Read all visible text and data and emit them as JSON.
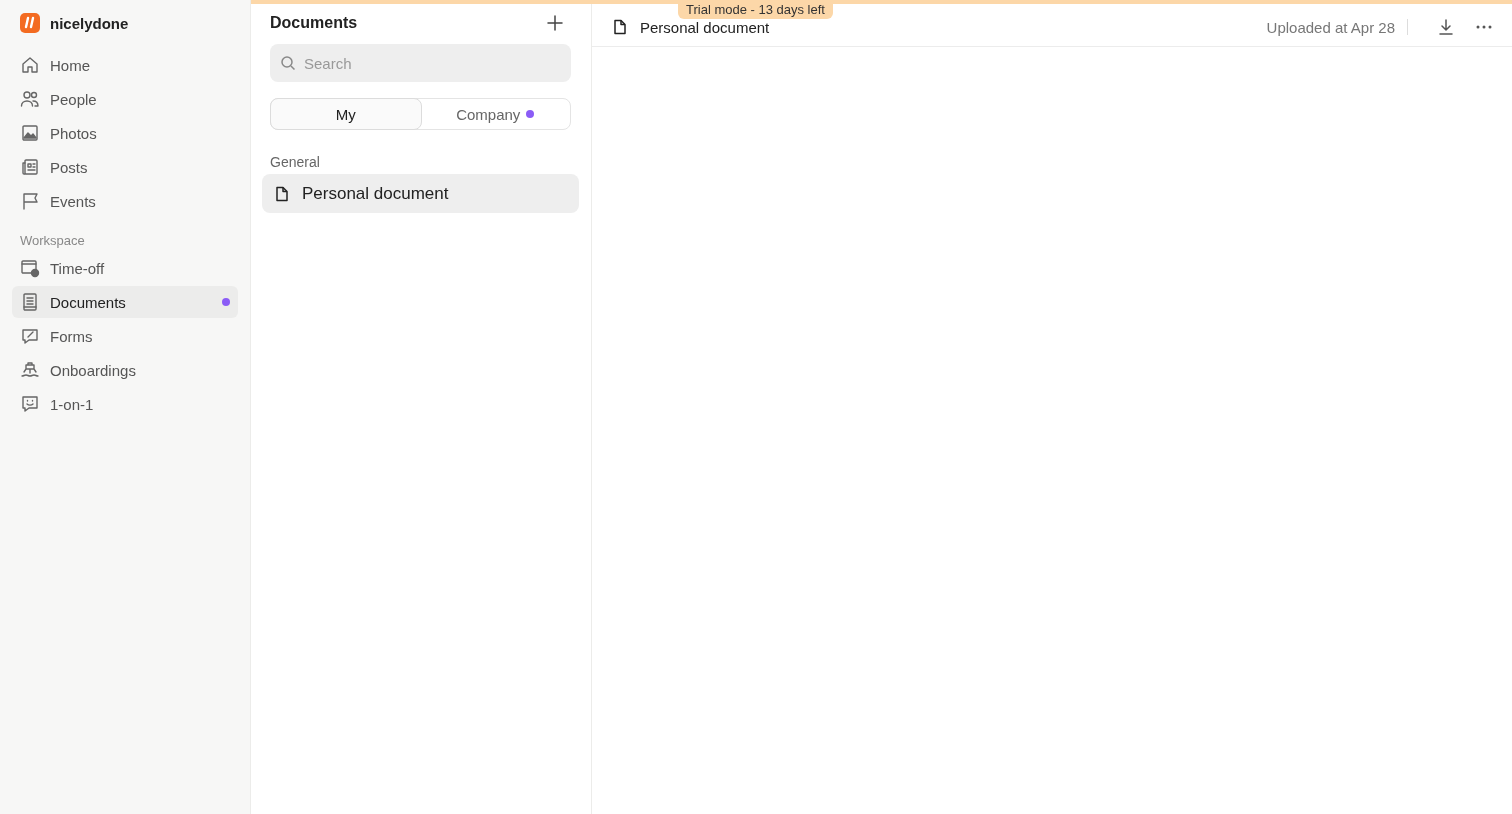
{
  "app": {
    "name": "nicelydone"
  },
  "sidebar": {
    "items": [
      {
        "label": "Home",
        "kind": "home",
        "selected": false,
        "unread": false
      },
      {
        "label": "People",
        "kind": "people",
        "selected": false,
        "unread": false
      },
      {
        "label": "Photos",
        "kind": "photos",
        "selected": false,
        "unread": false
      },
      {
        "label": "Posts",
        "kind": "posts",
        "selected": false,
        "unread": false
      },
      {
        "label": "Events",
        "kind": "events",
        "selected": false,
        "unread": false
      }
    ],
    "section_title": "Workspace",
    "workspace_items": [
      {
        "label": "Time-off",
        "kind": "timeoff",
        "selected": false,
        "unread": false
      },
      {
        "label": "Documents",
        "kind": "documents",
        "selected": true,
        "unread": true
      },
      {
        "label": "Forms",
        "kind": "forms",
        "selected": false,
        "unread": false
      },
      {
        "label": "Onboardings",
        "kind": "onboardings",
        "selected": false,
        "unread": false
      },
      {
        "label": "1-on-1",
        "kind": "oneonone",
        "selected": false,
        "unread": false
      }
    ]
  },
  "list_panel": {
    "title": "Documents",
    "search": {
      "placeholder": "Search"
    },
    "tabs": [
      {
        "label": "My",
        "selected": true,
        "unread": false
      },
      {
        "label": "Company",
        "selected": false,
        "unread": true
      }
    ],
    "groups": [
      {
        "title": "General",
        "documents": [
          {
            "name": "Personal document",
            "selected": true
          }
        ]
      }
    ]
  },
  "banner": {
    "text": "Trial mode - 13 days left"
  },
  "document_header": {
    "title": "Personal document",
    "uploaded": "Uploaded at Apr 28"
  }
}
